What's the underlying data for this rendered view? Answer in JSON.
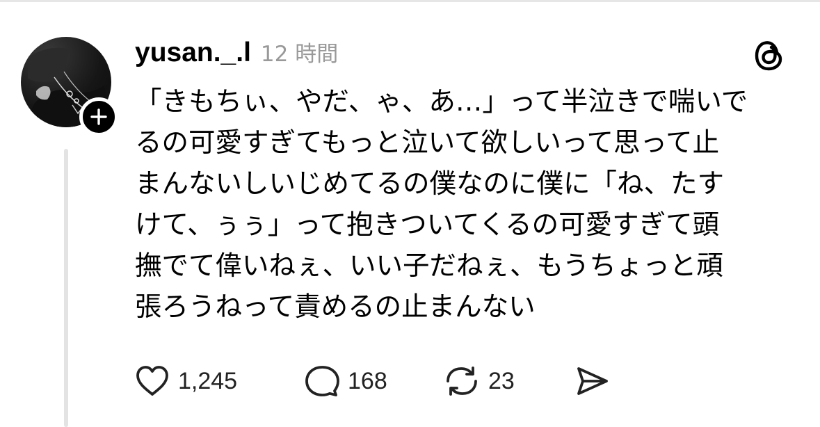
{
  "post": {
    "username": "yusan._.l",
    "timestamp": "12 時間",
    "body_lines": [
      "「きもちぃ、やだ、ゃ、あ…」って半泣きで喘いで",
      "るの可愛すぎてもっと泣いて欲しいって思って止",
      "まんないしいじめてるの僕なのに僕に「ね、たす",
      "けて、ぅぅ」って抱きついてくるの可愛すぎて頭",
      "撫でて偉いねぇ、いい子だねぇ、もうちょっと頑",
      "張ろうねって責めるの止まんない"
    ]
  },
  "actions": {
    "likes": "1,245",
    "replies": "168",
    "reposts": "23"
  },
  "icons": {
    "avatar": "avatar",
    "follow": "plus-icon",
    "app_logo": "threads-logo-icon",
    "like": "heart-icon",
    "reply": "comment-bubble-icon",
    "repost": "repost-icon",
    "share": "send-icon"
  },
  "colors": {
    "text": "#000000",
    "muted": "#999999",
    "thread_line": "#e3e3e3"
  }
}
